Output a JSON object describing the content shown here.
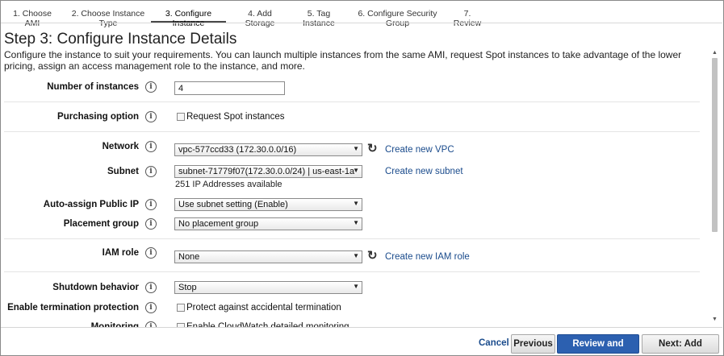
{
  "wizard": {
    "steps": [
      {
        "label": "1. Choose AMI"
      },
      {
        "label": "2. Choose Instance Type"
      },
      {
        "label": "3. Configure Instance"
      },
      {
        "label": "4. Add Storage"
      },
      {
        "label": "5. Tag Instance"
      },
      {
        "label": "6. Configure Security Group"
      },
      {
        "label": "7. Review"
      }
    ],
    "active_step": "3. Configure Instance"
  },
  "page": {
    "title": "Step 3: Configure Instance Details",
    "intro": "Configure the instance to suit your requirements. You can launch multiple instances from the same AMI, request Spot instances to take advantage of the lower pricing, assign an access management role to the instance, and more."
  },
  "form": {
    "number_of_instances": {
      "label": "Number of instances",
      "value": "4"
    },
    "purchasing_option": {
      "label": "Purchasing option",
      "checkbox_label": "Request Spot instances",
      "checked": false
    },
    "network": {
      "label": "Network",
      "value": "vpc-577ccd33 (172.30.0.0/16)",
      "link": "Create new VPC"
    },
    "subnet": {
      "label": "Subnet",
      "value": "subnet-71779f07(172.30.0.0/24) | us-east-1a",
      "link": "Create new subnet",
      "note": "251 IP Addresses available"
    },
    "auto_assign_ip": {
      "label": "Auto-assign Public IP",
      "value": "Use subnet setting (Enable)"
    },
    "placement_group": {
      "label": "Placement group",
      "value": "No placement group"
    },
    "iam_role": {
      "label": "IAM role",
      "value": "None",
      "link": "Create new IAM role"
    },
    "shutdown_behavior": {
      "label": "Shutdown behavior",
      "value": "Stop"
    },
    "termination_protection": {
      "label": "Enable termination protection",
      "checkbox_label": "Protect against accidental termination",
      "checked": false
    },
    "monitoring": {
      "label": "Monitoring",
      "checkbox_label": "Enable CloudWatch detailed monitoring",
      "checked": false
    }
  },
  "icons": {
    "info": "info-icon",
    "refresh": "refresh-icon",
    "dropdown": "chevron-down-icon"
  },
  "info_glyph": "i",
  "refresh_glyph": "↻",
  "arrow_glyph": "▼",
  "scroll_up_glyph": "▲",
  "scroll_down_glyph": "▼",
  "footer": {
    "cancel": "Cancel",
    "previous": "Previous",
    "review_launch": "Review and Launch",
    "next": "Next: Add Storage"
  },
  "colors": {
    "primary_button": "#2c60b0",
    "link": "#1a4b8c"
  }
}
